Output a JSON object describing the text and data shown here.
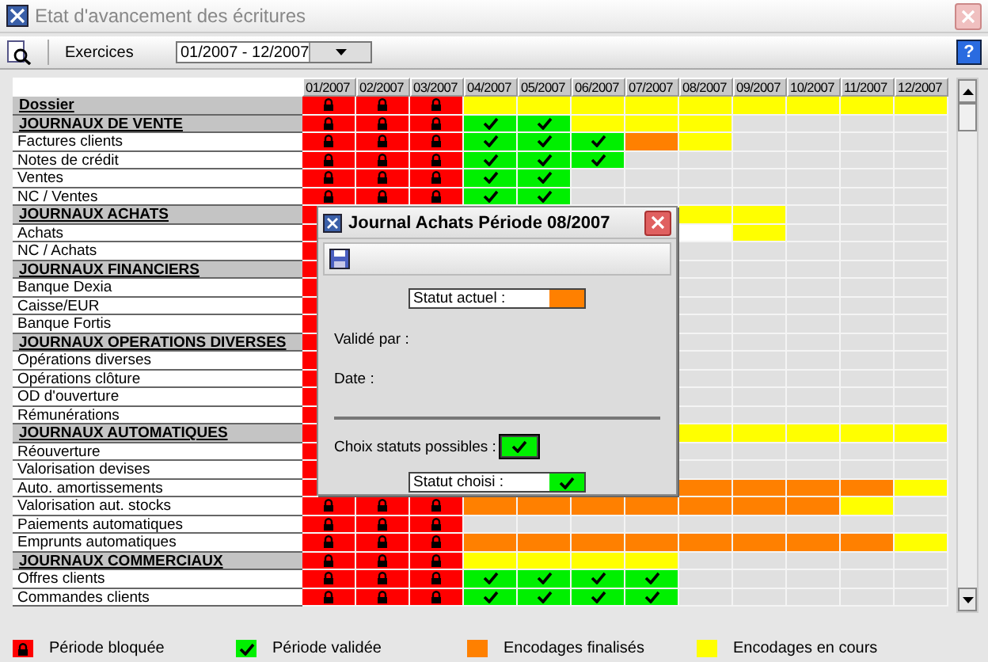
{
  "window": {
    "title": "Etat d'avancement des écritures"
  },
  "toolbar": {
    "label": "Exercices",
    "period": "01/2007 - 12/2007",
    "help": "?"
  },
  "grid": {
    "months": [
      "01/2007",
      "02/2007",
      "03/2007",
      "04/2007",
      "05/2007",
      "06/2007",
      "07/2007",
      "08/2007",
      "09/2007",
      "10/2007",
      "11/2007",
      "12/2007"
    ],
    "rows": [
      {
        "label": "Dossier",
        "kind": "group",
        "cells": [
          {
            "kind": "blocked"
          },
          {
            "kind": "blocked"
          },
          {
            "kind": "blocked"
          },
          {
            "kind": "in_progress"
          },
          {
            "kind": "in_progress"
          },
          {
            "kind": "in_progress"
          },
          {
            "kind": "in_progress"
          },
          {
            "kind": "in_progress"
          },
          {
            "kind": "in_progress"
          },
          {
            "kind": "in_progress"
          },
          {
            "kind": "in_progress"
          },
          {
            "kind": "in_progress"
          }
        ]
      },
      {
        "label": "JOURNAUX DE VENTE",
        "kind": "group",
        "cells": [
          {
            "kind": "blocked"
          },
          {
            "kind": "blocked"
          },
          {
            "kind": "blocked"
          },
          {
            "kind": "validated"
          },
          {
            "kind": "validated"
          },
          {
            "kind": "in_progress"
          },
          {
            "kind": "in_progress"
          },
          {
            "kind": "in_progress"
          },
          {
            "kind": "empty"
          },
          {
            "kind": "empty"
          },
          {
            "kind": "empty"
          },
          {
            "kind": "empty"
          }
        ]
      },
      {
        "label": "Factures clients",
        "kind": "item",
        "cells": [
          {
            "kind": "blocked"
          },
          {
            "kind": "blocked"
          },
          {
            "kind": "blocked"
          },
          {
            "kind": "validated"
          },
          {
            "kind": "validated"
          },
          {
            "kind": "validated"
          },
          {
            "kind": "finalized"
          },
          {
            "kind": "in_progress"
          },
          {
            "kind": "empty"
          },
          {
            "kind": "empty"
          },
          {
            "kind": "empty"
          },
          {
            "kind": "empty"
          }
        ]
      },
      {
        "label": "Notes de crédit",
        "kind": "item",
        "cells": [
          {
            "kind": "blocked"
          },
          {
            "kind": "blocked"
          },
          {
            "kind": "blocked"
          },
          {
            "kind": "validated"
          },
          {
            "kind": "validated"
          },
          {
            "kind": "validated"
          },
          {
            "kind": "empty"
          },
          {
            "kind": "empty"
          },
          {
            "kind": "empty"
          },
          {
            "kind": "empty"
          },
          {
            "kind": "empty"
          },
          {
            "kind": "empty"
          }
        ]
      },
      {
        "label": "Ventes",
        "kind": "item",
        "cells": [
          {
            "kind": "blocked"
          },
          {
            "kind": "blocked"
          },
          {
            "kind": "blocked"
          },
          {
            "kind": "validated"
          },
          {
            "kind": "validated"
          },
          {
            "kind": "empty"
          },
          {
            "kind": "empty"
          },
          {
            "kind": "empty"
          },
          {
            "kind": "empty"
          },
          {
            "kind": "empty"
          },
          {
            "kind": "empty"
          },
          {
            "kind": "empty"
          }
        ]
      },
      {
        "label": "NC / Ventes",
        "kind": "item",
        "cells": [
          {
            "kind": "blocked"
          },
          {
            "kind": "blocked"
          },
          {
            "kind": "blocked"
          },
          {
            "kind": "validated"
          },
          {
            "kind": "validated"
          },
          {
            "kind": "empty"
          },
          {
            "kind": "empty"
          },
          {
            "kind": "empty"
          },
          {
            "kind": "empty"
          },
          {
            "kind": "empty"
          },
          {
            "kind": "empty"
          },
          {
            "kind": "empty"
          }
        ]
      },
      {
        "label": "JOURNAUX ACHATS",
        "kind": "group",
        "cells": [
          {
            "kind": "blocked"
          },
          null,
          null,
          null,
          null,
          null,
          null,
          {
            "kind": "in_progress"
          },
          {
            "kind": "in_progress"
          },
          {
            "kind": "empty"
          },
          {
            "kind": "empty"
          },
          {
            "kind": "empty"
          }
        ]
      },
      {
        "label": "Achats",
        "kind": "item",
        "cells": [
          {
            "kind": "blocked"
          },
          null,
          null,
          null,
          null,
          null,
          null,
          {
            "kind": "selected"
          },
          {
            "kind": "in_progress"
          },
          {
            "kind": "empty"
          },
          {
            "kind": "empty"
          },
          {
            "kind": "empty"
          }
        ]
      },
      {
        "label": "NC / Achats",
        "kind": "item",
        "cells": [
          {
            "kind": "blocked"
          },
          null,
          null,
          null,
          null,
          null,
          null,
          {
            "kind": "empty"
          },
          {
            "kind": "empty"
          },
          {
            "kind": "empty"
          },
          {
            "kind": "empty"
          },
          {
            "kind": "empty"
          }
        ]
      },
      {
        "label": "JOURNAUX FINANCIERS",
        "kind": "group",
        "cells": [
          {
            "kind": "blocked"
          },
          null,
          null,
          null,
          null,
          null,
          null,
          {
            "kind": "empty"
          },
          {
            "kind": "empty"
          },
          {
            "kind": "empty"
          },
          {
            "kind": "empty"
          },
          {
            "kind": "empty"
          }
        ]
      },
      {
        "label": "Banque Dexia",
        "kind": "item",
        "cells": [
          {
            "kind": "blocked"
          },
          null,
          null,
          null,
          null,
          null,
          null,
          {
            "kind": "empty"
          },
          {
            "kind": "empty"
          },
          {
            "kind": "empty"
          },
          {
            "kind": "empty"
          },
          {
            "kind": "empty"
          }
        ]
      },
      {
        "label": "Caisse/EUR",
        "kind": "item",
        "cells": [
          {
            "kind": "blocked"
          },
          null,
          null,
          null,
          null,
          null,
          null,
          {
            "kind": "empty"
          },
          {
            "kind": "empty"
          },
          {
            "kind": "empty"
          },
          {
            "kind": "empty"
          },
          {
            "kind": "empty"
          }
        ]
      },
      {
        "label": "Banque Fortis",
        "kind": "item",
        "cells": [
          {
            "kind": "blocked"
          },
          null,
          null,
          null,
          null,
          null,
          null,
          {
            "kind": "empty"
          },
          {
            "kind": "empty"
          },
          {
            "kind": "empty"
          },
          {
            "kind": "empty"
          },
          {
            "kind": "empty"
          }
        ]
      },
      {
        "label": "JOURNAUX OPERATIONS DIVERSES",
        "kind": "group",
        "cells": [
          {
            "kind": "blocked"
          },
          null,
          null,
          null,
          null,
          null,
          null,
          {
            "kind": "empty"
          },
          {
            "kind": "empty"
          },
          {
            "kind": "empty"
          },
          {
            "kind": "empty"
          },
          {
            "kind": "empty"
          }
        ]
      },
      {
        "label": "Opérations diverses",
        "kind": "item",
        "cells": [
          {
            "kind": "blocked"
          },
          null,
          null,
          null,
          null,
          null,
          null,
          {
            "kind": "empty"
          },
          {
            "kind": "empty"
          },
          {
            "kind": "empty"
          },
          {
            "kind": "empty"
          },
          {
            "kind": "empty"
          }
        ]
      },
      {
        "label": "Opérations clôture",
        "kind": "item",
        "cells": [
          {
            "kind": "blocked"
          },
          null,
          null,
          null,
          null,
          null,
          null,
          {
            "kind": "empty"
          },
          {
            "kind": "empty"
          },
          {
            "kind": "empty"
          },
          {
            "kind": "empty"
          },
          {
            "kind": "empty"
          }
        ]
      },
      {
        "label": "OD d'ouverture",
        "kind": "item",
        "cells": [
          {
            "kind": "blocked"
          },
          null,
          null,
          null,
          null,
          null,
          null,
          {
            "kind": "empty"
          },
          {
            "kind": "empty"
          },
          {
            "kind": "empty"
          },
          {
            "kind": "empty"
          },
          {
            "kind": "empty"
          }
        ]
      },
      {
        "label": "Rémunérations",
        "kind": "item",
        "cells": [
          {
            "kind": "blocked"
          },
          null,
          null,
          null,
          null,
          null,
          null,
          {
            "kind": "empty"
          },
          {
            "kind": "empty"
          },
          {
            "kind": "empty"
          },
          {
            "kind": "empty"
          },
          {
            "kind": "empty"
          }
        ]
      },
      {
        "label": "JOURNAUX AUTOMATIQUES",
        "kind": "group",
        "cells": [
          {
            "kind": "blocked"
          },
          null,
          null,
          null,
          null,
          null,
          null,
          {
            "kind": "in_progress"
          },
          {
            "kind": "in_progress"
          },
          {
            "kind": "in_progress"
          },
          {
            "kind": "in_progress"
          },
          {
            "kind": "in_progress"
          }
        ]
      },
      {
        "label": "Réouverture",
        "kind": "item",
        "cells": [
          {
            "kind": "blocked"
          },
          null,
          null,
          null,
          null,
          null,
          null,
          {
            "kind": "empty"
          },
          {
            "kind": "empty"
          },
          {
            "kind": "empty"
          },
          {
            "kind": "empty"
          },
          {
            "kind": "empty"
          }
        ]
      },
      {
        "label": "Valorisation devises",
        "kind": "item",
        "cells": [
          {
            "kind": "blocked"
          },
          null,
          null,
          null,
          null,
          null,
          null,
          {
            "kind": "empty"
          },
          {
            "kind": "empty"
          },
          {
            "kind": "empty"
          },
          {
            "kind": "empty"
          },
          {
            "kind": "empty"
          }
        ]
      },
      {
        "label": "Auto. amortissements",
        "kind": "item",
        "cells": [
          {
            "kind": "blocked"
          },
          null,
          null,
          null,
          null,
          null,
          null,
          {
            "kind": "finalized"
          },
          {
            "kind": "finalized"
          },
          {
            "kind": "finalized"
          },
          {
            "kind": "finalized"
          },
          {
            "kind": "in_progress"
          }
        ]
      },
      {
        "label": "Valorisation aut. stocks",
        "kind": "item",
        "cells": [
          {
            "kind": "blocked"
          },
          {
            "kind": "blocked"
          },
          {
            "kind": "blocked"
          },
          {
            "kind": "finalized"
          },
          {
            "kind": "finalized"
          },
          {
            "kind": "finalized"
          },
          {
            "kind": "finalized"
          },
          {
            "kind": "finalized"
          },
          {
            "kind": "finalized"
          },
          {
            "kind": "finalized"
          },
          {
            "kind": "in_progress"
          },
          {
            "kind": "empty"
          }
        ]
      },
      {
        "label": "Paiements automatiques",
        "kind": "item",
        "cells": [
          {
            "kind": "blocked"
          },
          {
            "kind": "blocked"
          },
          {
            "kind": "blocked"
          },
          {
            "kind": "empty"
          },
          {
            "kind": "empty"
          },
          {
            "kind": "empty"
          },
          {
            "kind": "empty"
          },
          {
            "kind": "empty"
          },
          {
            "kind": "empty"
          },
          {
            "kind": "empty"
          },
          {
            "kind": "empty"
          },
          {
            "kind": "empty"
          }
        ]
      },
      {
        "label": "Emprunts automatiques",
        "kind": "item",
        "cells": [
          {
            "kind": "blocked"
          },
          {
            "kind": "blocked"
          },
          {
            "kind": "blocked"
          },
          {
            "kind": "finalized"
          },
          {
            "kind": "finalized"
          },
          {
            "kind": "finalized"
          },
          {
            "kind": "finalized"
          },
          {
            "kind": "finalized"
          },
          {
            "kind": "finalized"
          },
          {
            "kind": "finalized"
          },
          {
            "kind": "finalized"
          },
          {
            "kind": "in_progress"
          }
        ]
      },
      {
        "label": "JOURNAUX COMMERCIAUX",
        "kind": "group",
        "cells": [
          {
            "kind": "blocked"
          },
          {
            "kind": "blocked"
          },
          {
            "kind": "blocked"
          },
          {
            "kind": "in_progress"
          },
          {
            "kind": "in_progress"
          },
          {
            "kind": "in_progress"
          },
          {
            "kind": "in_progress"
          },
          {
            "kind": "empty"
          },
          {
            "kind": "empty"
          },
          {
            "kind": "empty"
          },
          {
            "kind": "empty"
          },
          {
            "kind": "empty"
          }
        ]
      },
      {
        "label": "Offres clients",
        "kind": "item",
        "cells": [
          {
            "kind": "blocked"
          },
          {
            "kind": "blocked"
          },
          {
            "kind": "blocked"
          },
          {
            "kind": "validated"
          },
          {
            "kind": "validated"
          },
          {
            "kind": "validated"
          },
          {
            "kind": "validated"
          },
          {
            "kind": "empty"
          },
          {
            "kind": "empty"
          },
          {
            "kind": "empty"
          },
          {
            "kind": "empty"
          },
          {
            "kind": "empty"
          }
        ]
      },
      {
        "label": "Commandes clients",
        "kind": "item",
        "cells": [
          {
            "kind": "blocked"
          },
          {
            "kind": "blocked"
          },
          {
            "kind": "blocked"
          },
          {
            "kind": "validated"
          },
          {
            "kind": "validated"
          },
          {
            "kind": "validated"
          },
          {
            "kind": "validated"
          },
          {
            "kind": "empty"
          },
          {
            "kind": "empty"
          },
          {
            "kind": "empty"
          },
          {
            "kind": "empty"
          },
          {
            "kind": "empty"
          }
        ]
      }
    ]
  },
  "dialog": {
    "title": "Journal Achats Période 08/2007",
    "current_status": {
      "label": "Statut actuel :",
      "kind": "finalized"
    },
    "validated_by": "Validé par :",
    "date": "Date :",
    "choices": {
      "label": "Choix statuts possibles :",
      "options": [
        {
          "kind": "validated",
          "selected": true
        }
      ]
    },
    "chosen_status": {
      "label": "Statut choisi :",
      "kind": "validated"
    }
  },
  "legend": [
    {
      "label": "Période bloquée",
      "kind": "blocked"
    },
    {
      "label": "Période validée",
      "kind": "validated"
    },
    {
      "label": "Encodages finalisés",
      "kind": "finalized"
    },
    {
      "label": "Encodages en cours",
      "kind": "in_progress"
    }
  ]
}
